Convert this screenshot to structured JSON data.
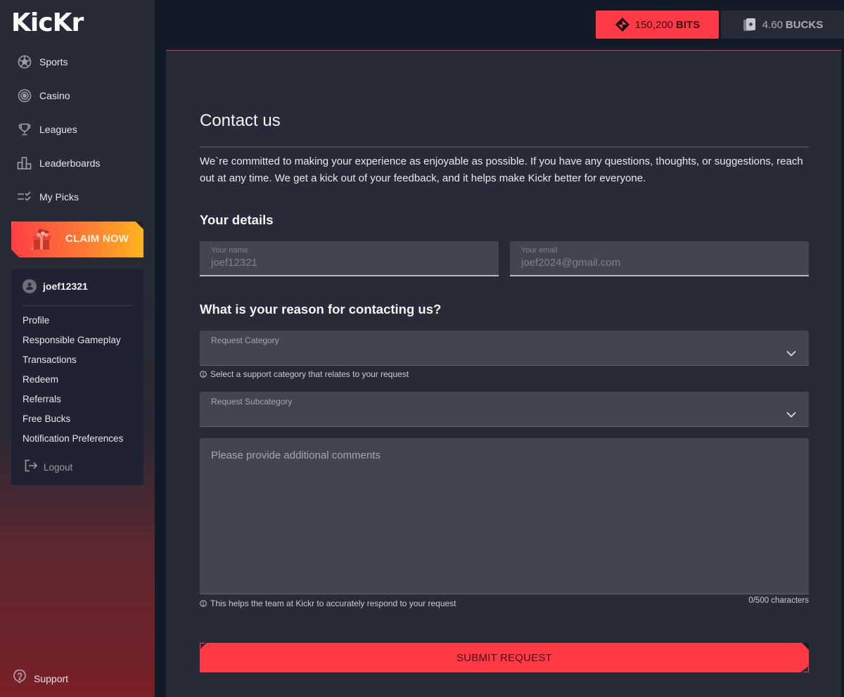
{
  "app": {
    "logo": "KicKr"
  },
  "sidebar": {
    "nav": [
      {
        "label": "Sports",
        "icon": "soccer-ball-icon"
      },
      {
        "label": "Casino",
        "icon": "casino-chip-icon"
      },
      {
        "label": "Leagues",
        "icon": "trophy-icon"
      },
      {
        "label": "Leaderboards",
        "icon": "leaderboard-icon"
      },
      {
        "label": "My Picks",
        "icon": "checklist-icon"
      }
    ],
    "claim_label": "CLAIM NOW",
    "user": {
      "username": "joef12321",
      "menu": [
        "Profile",
        "Responsible Gameplay",
        "Transactions",
        "Redeem",
        "Referrals",
        "Free Bucks",
        "Notification Preferences"
      ],
      "logout_label": "Logout"
    },
    "support_label": "Support"
  },
  "topbar": {
    "bits": {
      "amount": "150,200",
      "unit": "BITS"
    },
    "bucks": {
      "amount": "4.60",
      "unit": "BUCKS"
    }
  },
  "colors": {
    "accent": "#ff3a46",
    "panel": "#262b37",
    "field": "#41454f"
  },
  "contact": {
    "title": "Contact us",
    "intro": "We`re committed to making your experience as enjoyable as possible. If you have any questions, thoughts, or suggestions, reach out at any time. We get a kick out of your feedback, and it helps make Kickr better for everyone.",
    "details_heading": "Your details",
    "name": {
      "label": "Your name",
      "value": "joef12321"
    },
    "email": {
      "label": "Your email",
      "value": "joef2024@gmail.com"
    },
    "reason_heading": "What is your reason for contacting us?",
    "category": {
      "label": "Request Category",
      "hint": "Select a support category that relates to your request"
    },
    "subcategory": {
      "label": "Request Subcategory"
    },
    "comments": {
      "placeholder": "Please provide additional comments",
      "hint": "This helps the team at Kickr to accurately respond to your request",
      "count": "0/500 characters"
    },
    "submit_label": "SUBMIT REQUEST"
  }
}
